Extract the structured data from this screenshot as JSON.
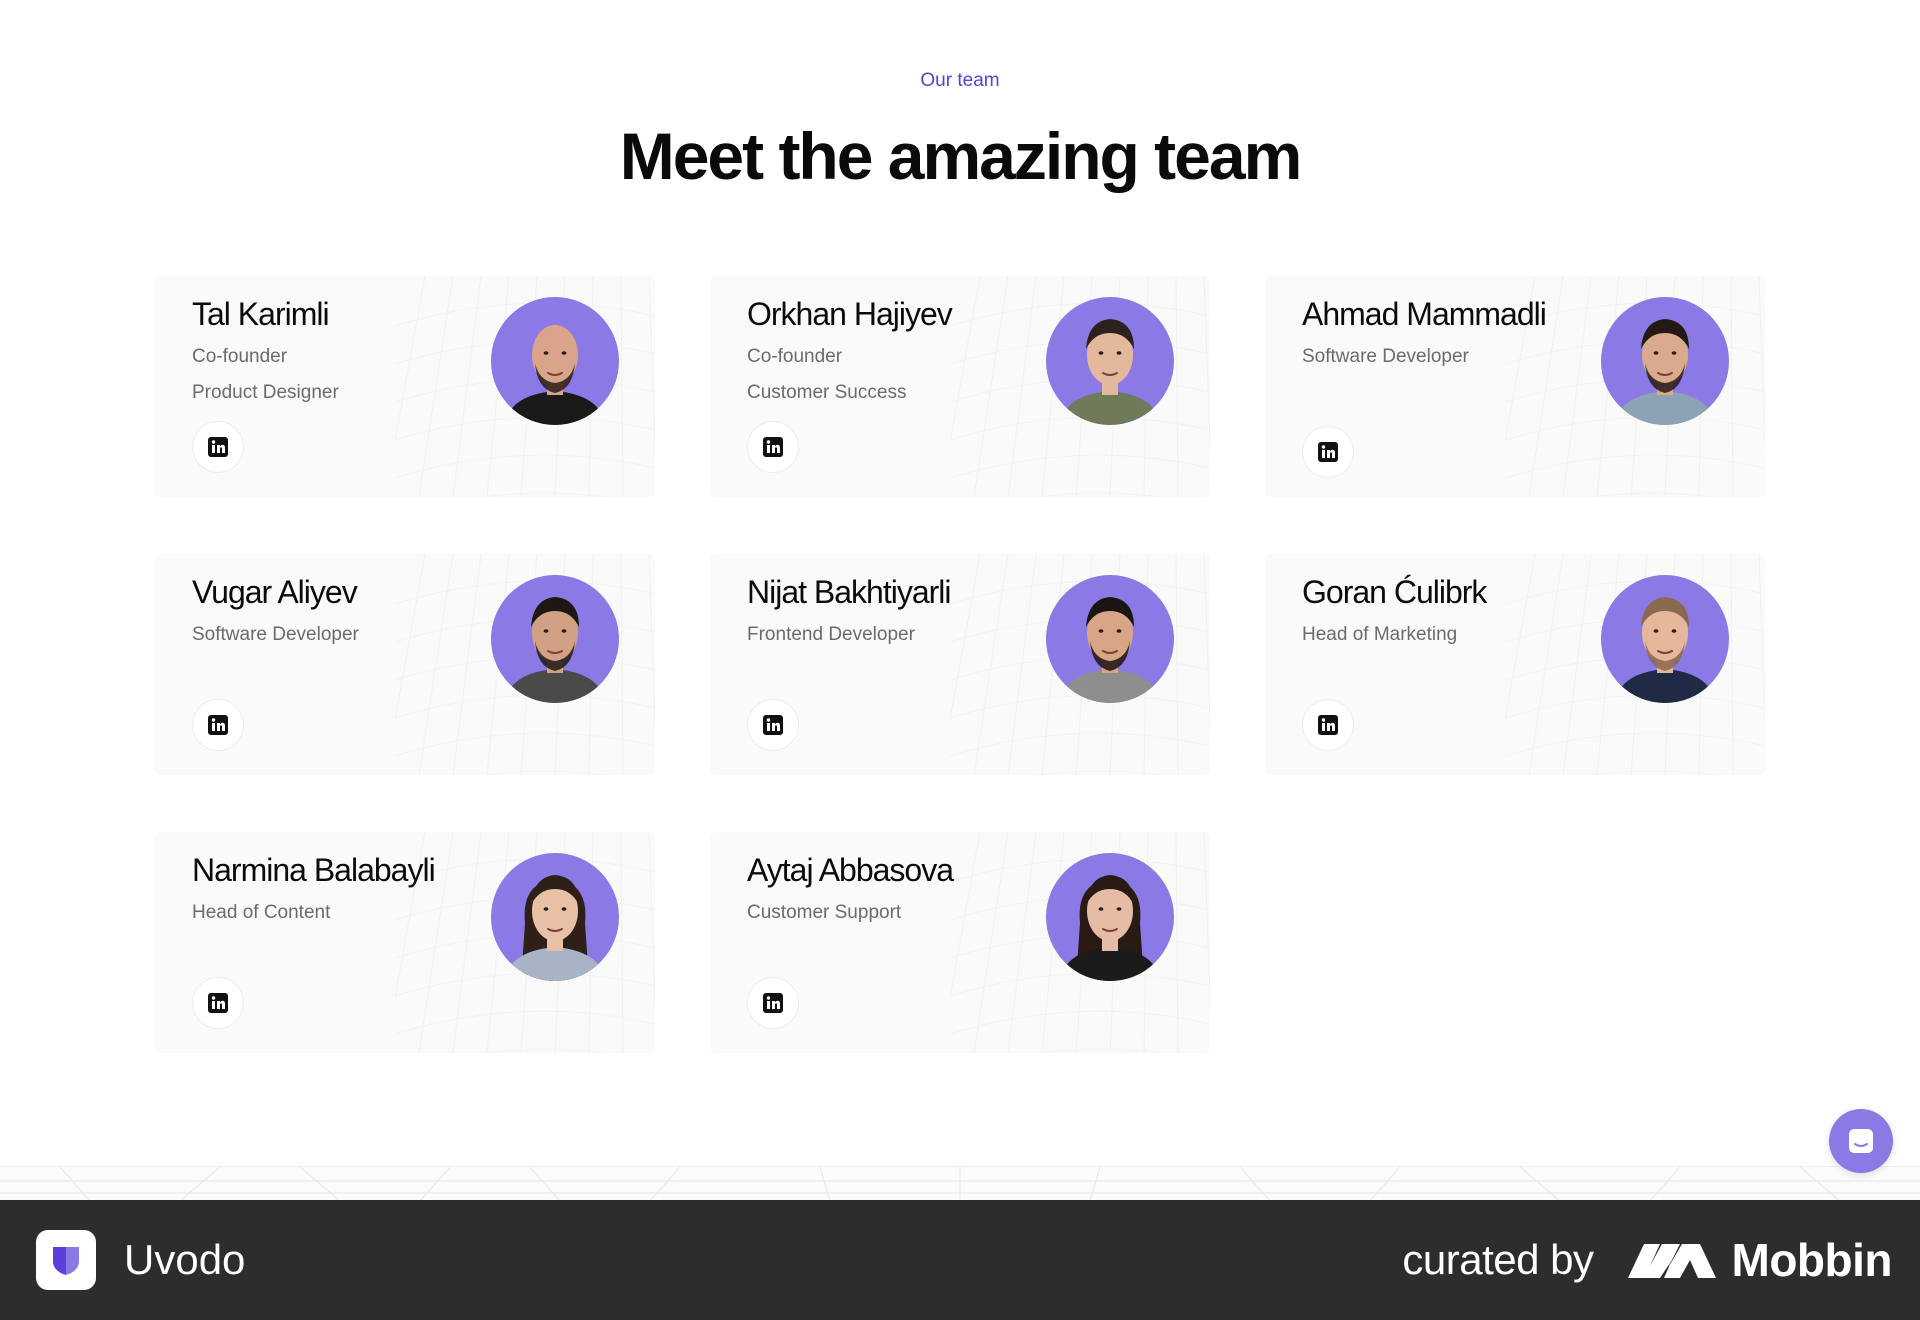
{
  "section": {
    "eyebrow": "Our team",
    "heading": "Meet the amazing team"
  },
  "team": [
    {
      "name": "Tal Karimli",
      "roles": [
        "Co-founder",
        "Product Designer"
      ],
      "skin": "#d9a48a",
      "hair": "#2a1c14",
      "shirt": "#1a1a1a",
      "beard": true,
      "bald": true
    },
    {
      "name": "Orkhan Hajiyev",
      "roles": [
        "Co-founder",
        "Customer Success"
      ],
      "skin": "#e3b89c",
      "hair": "#2b2220",
      "shirt": "#6f7a5a",
      "beard": false,
      "bald": false
    },
    {
      "name": "Ahmad Mammadli",
      "roles": [
        "Software Developer"
      ],
      "skin": "#d9aa8c",
      "hair": "#241a15",
      "shirt": "#8da3b5",
      "beard": true,
      "bald": false
    },
    {
      "name": "Vugar Aliyev",
      "roles": [
        "Software Developer"
      ],
      "skin": "#d2a082",
      "hair": "#1f1713",
      "shirt": "#4a4a4a",
      "beard": true,
      "bald": false
    },
    {
      "name": "Nijat Bakhtiyarli",
      "roles": [
        "Frontend Developer"
      ],
      "skin": "#d8a586",
      "hair": "#1c1410",
      "shirt": "#8e8e8e",
      "beard": true,
      "bald": false
    },
    {
      "name": "Goran Ćulibrk",
      "roles": [
        "Head of Marketing"
      ],
      "skin": "#e6b79b",
      "hair": "#8a6a4e",
      "shirt": "#1f2a44",
      "beard": true,
      "bald": false
    },
    {
      "name": "Narmina Balabayli",
      "roles": [
        "Head of Content"
      ],
      "skin": "#e8c0a6",
      "hair": "#2e2019",
      "shirt": "#a7b4c6",
      "beard": false,
      "bald": false,
      "long_hair": true
    },
    {
      "name": "Aytaj Abbasova",
      "roles": [
        "Customer Support"
      ],
      "skin": "#e6bda4",
      "hair": "#2a1a14",
      "shirt": "#1b1b1b",
      "beard": false,
      "bald": false,
      "long_hair": true
    }
  ],
  "footer": {
    "brand": "Uvodo",
    "curated_by": "curated by",
    "mobbin": "Mobbin"
  },
  "colors": {
    "accent": "#8b79e6",
    "eyebrow": "#5b3fd6",
    "footer_bg": "#2d2d2d"
  },
  "icons": {
    "social": "linkedin-icon",
    "chat": "chat-icon",
    "brand": "uvodo-logo-icon",
    "mobbin": "mobbin-logo-icon"
  }
}
